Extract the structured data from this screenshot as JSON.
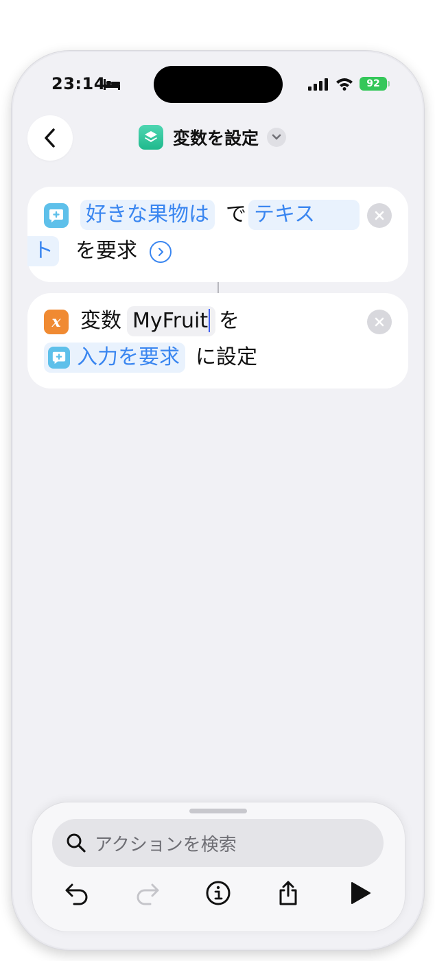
{
  "status_bar": {
    "time": "23:14",
    "battery": "92"
  },
  "nav": {
    "title": "変数を設定"
  },
  "action1": {
    "prompt": "好きな果物は",
    "particle_de": "で",
    "type_part1": "テキス",
    "type_part2": "ト",
    "suffix": "を要求"
  },
  "action2": {
    "label_var": "変数",
    "var_name": "MyFruit",
    "particle_wo": "を",
    "source": "入力を要求",
    "suffix": "に設定"
  },
  "search": {
    "placeholder": "アクションを検索"
  },
  "colors": {
    "accent": "#3a86f0",
    "variable_icon": "#f08a32",
    "ask_icon": "#5ec0ea",
    "battery": "#34c759"
  },
  "icons": {
    "back": "chevron-left-icon",
    "app": "layers-icon",
    "menu": "chevron-down-icon",
    "remove": "x-icon",
    "undo": "undo-icon",
    "redo": "redo-icon",
    "info": "info-icon",
    "share": "share-icon",
    "run": "play-icon"
  }
}
